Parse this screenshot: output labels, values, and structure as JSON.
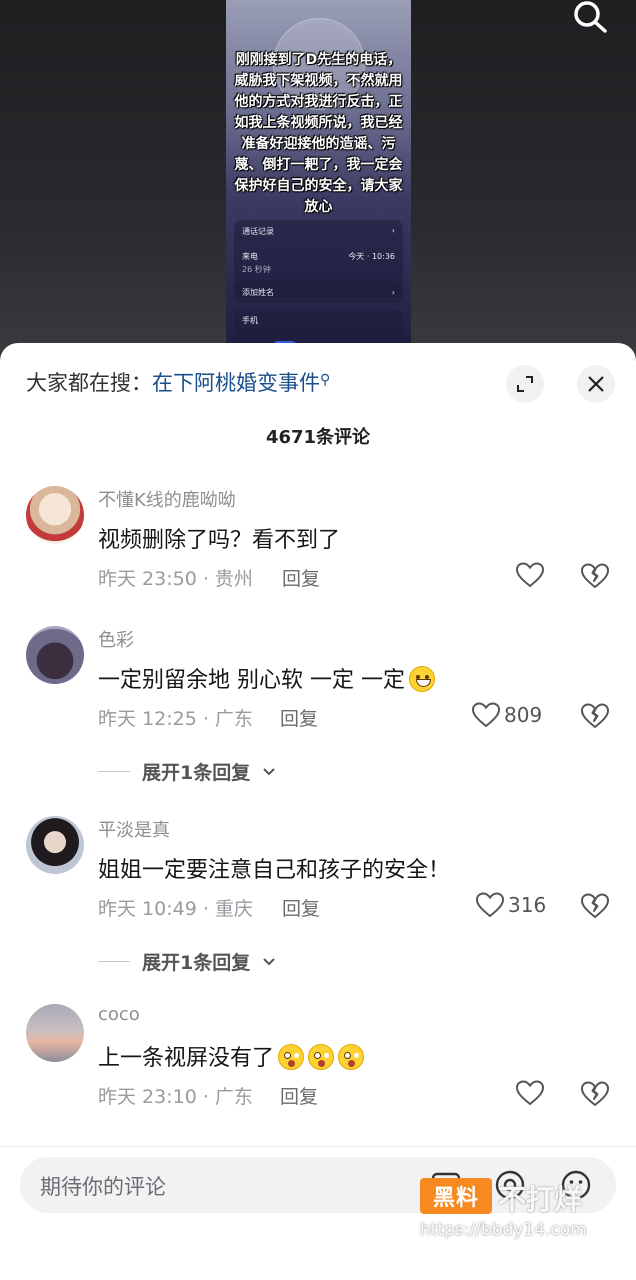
{
  "video": {
    "caption": "刚刚接到了D先生的电话，威胁我下架视频，不然就用他的方式对我进行反击，正如我上条视频所说，我已经准备好迎接他的造谣、污蔑、倒打一耙了，我一定会保护好自己的安全，请大家放心",
    "call_history_label": "通话记录",
    "incoming_label": "来电",
    "duration": "26 秒钟",
    "time": "今天 · 10:36",
    "add_name_label": "添加姓名",
    "phone_label": "手机"
  },
  "search": {
    "prefix": "大家都在搜：",
    "topic": "在下阿桃婚变事件"
  },
  "comments_title": "4671条评论",
  "comments": [
    {
      "user": "不懂K线的鹿呦呦",
      "text": "视频删除了吗？看不到了",
      "meta": "昨天 23:50 · 贵州",
      "reply": "回复",
      "likes": ""
    },
    {
      "user": "色彩",
      "text": "一定别留余地 别心软 一定 一定",
      "meta": "昨天 12:25 · 广东",
      "reply": "回复",
      "likes": "809",
      "expand": "展开1条回复"
    },
    {
      "user": "平淡是真",
      "text": "姐姐一定要注意自己和孩子的安全！",
      "meta": "昨天 10:49 · 重庆",
      "reply": "回复",
      "likes": "316",
      "expand": "展开1条回复"
    },
    {
      "user": "coco",
      "text": "上一条视屏没有了",
      "meta": "昨天 23:10 · 广东",
      "reply": "回复",
      "likes": ""
    }
  ],
  "input": {
    "placeholder": "期待你的评论"
  },
  "watermark": {
    "badge": "黑料",
    "name": "不打烊",
    "url": "https://bbdy14.com"
  },
  "colors": {
    "topic": "#1a4f8b",
    "sheet": "#ffffff",
    "badge": "#f58a20"
  }
}
